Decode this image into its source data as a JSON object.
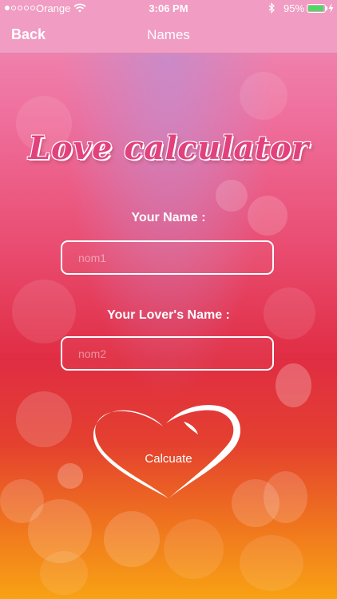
{
  "status_bar": {
    "carrier": "Orange",
    "time": "3:06 PM",
    "battery_percent": "95%",
    "battery_level": 0.95,
    "battery_color": "#4cd964",
    "signal_bars_filled": 1,
    "signal_bars_total": 5,
    "icons": [
      "wifi-icon",
      "bluetooth-icon",
      "battery-icon",
      "charging-icon"
    ]
  },
  "nav": {
    "back_label": "Back",
    "title": "Names"
  },
  "main": {
    "app_title": "Love calculator",
    "your_name_label": "Your Name :",
    "your_name_placeholder": "nom1",
    "your_name_value": "",
    "lover_name_label": "Your Lover's Name :",
    "lover_name_placeholder": "nom2",
    "lover_name_value": "",
    "calculate_label": "Calcuate",
    "calculate_icon": "heart-outline-icon"
  },
  "colors": {
    "nav_background": "#f09cc3",
    "title_pink": "#e2417d",
    "gradient_top": "#ef8fb8",
    "gradient_mid": "#e02d43",
    "gradient_bottom": "#f8a214"
  }
}
